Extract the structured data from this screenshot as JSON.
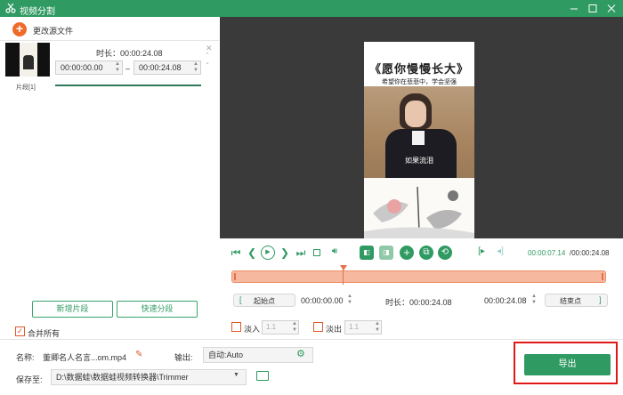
{
  "window": {
    "title": "视频分割"
  },
  "toolbar": {
    "change_source_label": "更改源文件"
  },
  "segment": {
    "label": "片段[1]",
    "duration_label": "时长：",
    "duration_value": "00:00:24.08",
    "start": "00:00:00.00",
    "dash": "–",
    "end": "00:00:24.08"
  },
  "left_buttons": {
    "add_segment": "新增片段",
    "quick_split": "快速分段"
  },
  "merge_all": {
    "label": "合并所有",
    "checked": true
  },
  "video_overlay": {
    "title": "《愿你慢慢长大》",
    "subtitle": "希望你在悲悲中，学会坚强",
    "caption": "如果流泪"
  },
  "playback": {
    "current": "00:00:07.14",
    "total": "/00:00:24.08",
    "progress": 0.2965
  },
  "range": {
    "start_button": "起始点",
    "start_time": "00:00:00.00",
    "duration_label": "时长：",
    "duration_value": "00:00:24.08",
    "end_time": "00:00:24.08",
    "end_button": "结束点"
  },
  "fade": {
    "fade_in_label": "淡入",
    "fade_in_value": "1.1",
    "fade_out_label": "淡出",
    "fade_out_value": "1.1"
  },
  "bottom": {
    "name_label": "名称:",
    "name_value": "董卿名人名言...om.mp4",
    "output_label": "输出:",
    "output_value": "自动:Auto",
    "save_label": "保存至:",
    "save_path": "D:\\数据蛙\\数据蛙视频转换器\\Trimmer",
    "export_label": "导出"
  },
  "colors": {
    "brand": "#2f9a62",
    "accent": "#f06a2a",
    "timeline": "#f6b9a0",
    "highlight": "#e01818"
  }
}
